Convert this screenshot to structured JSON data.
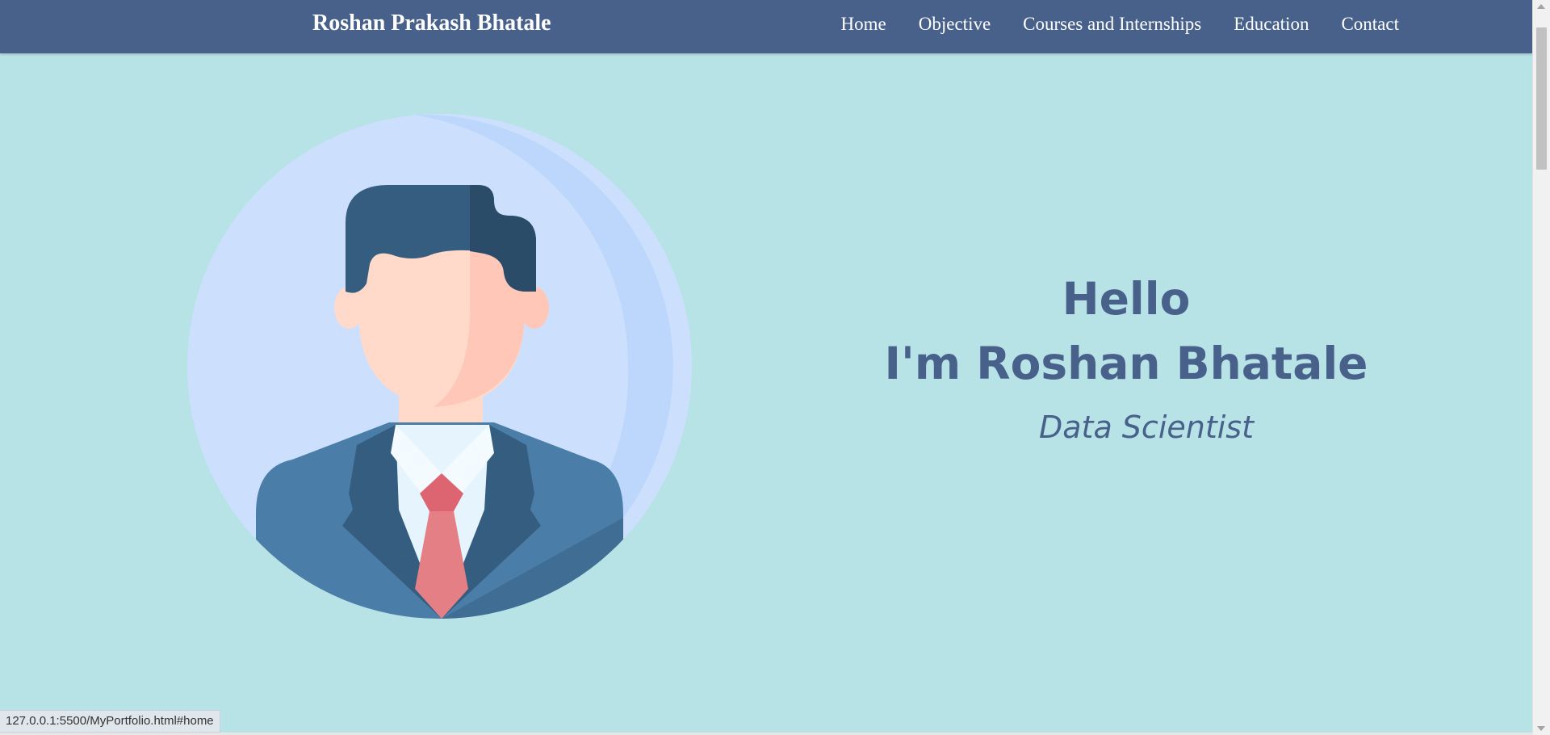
{
  "navbar": {
    "brand": "Roshan Prakash Bhatale",
    "links": [
      "Home",
      "Objective",
      "Courses and Internships",
      "Education",
      "Contact"
    ]
  },
  "hero": {
    "greeting": "Hello",
    "name": "I'm Roshan Bhatale",
    "role": "Data Scientist"
  },
  "avatar": {
    "icon": "businessman-avatar-icon"
  },
  "status_bar": {
    "url": "127.0.0.1:5500/MyPortfolio.html#home"
  },
  "colors": {
    "navbar": "#48618a",
    "background": "#b8e3e6",
    "hero_text": "#48618a",
    "avatar_circle": "#cce0fd",
    "avatar_circle_shade": "#bcd7fb",
    "suit": "#4a7ea8",
    "hair": "#345d80",
    "tie": "#e07a80"
  }
}
